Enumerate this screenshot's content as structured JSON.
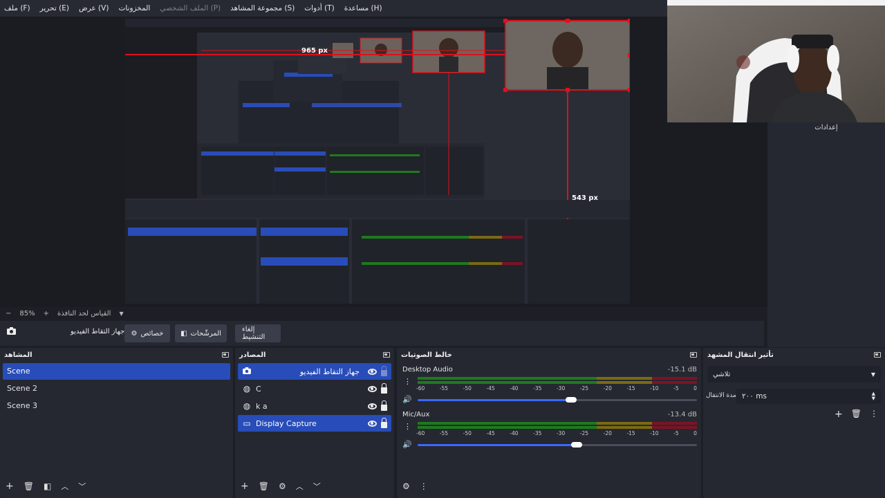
{
  "menu": {
    "items": [
      {
        "label": "ملف (F)",
        "disabled": false
      },
      {
        "label": "تحرير (E)",
        "disabled": false
      },
      {
        "label": "عرض (V)",
        "disabled": false
      },
      {
        "label": "المخزونات",
        "disabled": false
      },
      {
        "label": "الملف الشخصي (P)",
        "disabled": true
      },
      {
        "label": "مجموعة المشاهد (S)",
        "disabled": false
      },
      {
        "label": "أدوات (T)",
        "disabled": false
      },
      {
        "label": "مساعدة (H)",
        "disabled": false
      }
    ]
  },
  "preview": {
    "measure_width": "965 px",
    "measure_height": "543 px",
    "webcam_label": "إعدادات"
  },
  "zoom": {
    "value": "85%",
    "fit_label": "القياس لحد النافذة"
  },
  "source_toolbar": {
    "source_name": "جهاز التقاط الفيديو",
    "properties_label": "خصائص",
    "filters_label": "المرشّحات",
    "deactivate_label": "إلغاء التنشيط"
  },
  "scenes": {
    "title": "المشاهد",
    "items": [
      "Scene",
      "Scene 2",
      "Scene 3"
    ],
    "active_index": 0
  },
  "sources": {
    "title": "المصادر",
    "items": [
      {
        "name": "جهاز التقاط الفيديو",
        "icon": "camera-icon",
        "active": true
      },
      {
        "name": "C",
        "icon": "globe-icon",
        "active": false
      },
      {
        "name": "k a",
        "icon": "globe-icon",
        "active": false
      },
      {
        "name": "Display Capture",
        "icon": "monitor-icon",
        "active": true
      }
    ]
  },
  "mixer": {
    "title": "خالط الصوتيات",
    "ticks": [
      "-60",
      "-55",
      "-50",
      "-45",
      "-40",
      "-35",
      "-30",
      "-25",
      "-20",
      "-15",
      "-10",
      "-5",
      "0"
    ],
    "channels": [
      {
        "name": "Desktop Audio",
        "db": "-15.1 dB",
        "volume": 0.55
      },
      {
        "name": "Mic/Aux",
        "db": "-13.4 dB",
        "volume": 0.57
      }
    ]
  },
  "transitions": {
    "title": "تأثير انتقال المشهد",
    "selected": "تلاشي",
    "duration_label": "مدة الانتقال",
    "duration_value": "٢٠٠ ms"
  },
  "colors": {
    "accent": "#284cb8",
    "panel": "#252831",
    "background": "#1d1f26",
    "selection_red": "#e0101a"
  }
}
